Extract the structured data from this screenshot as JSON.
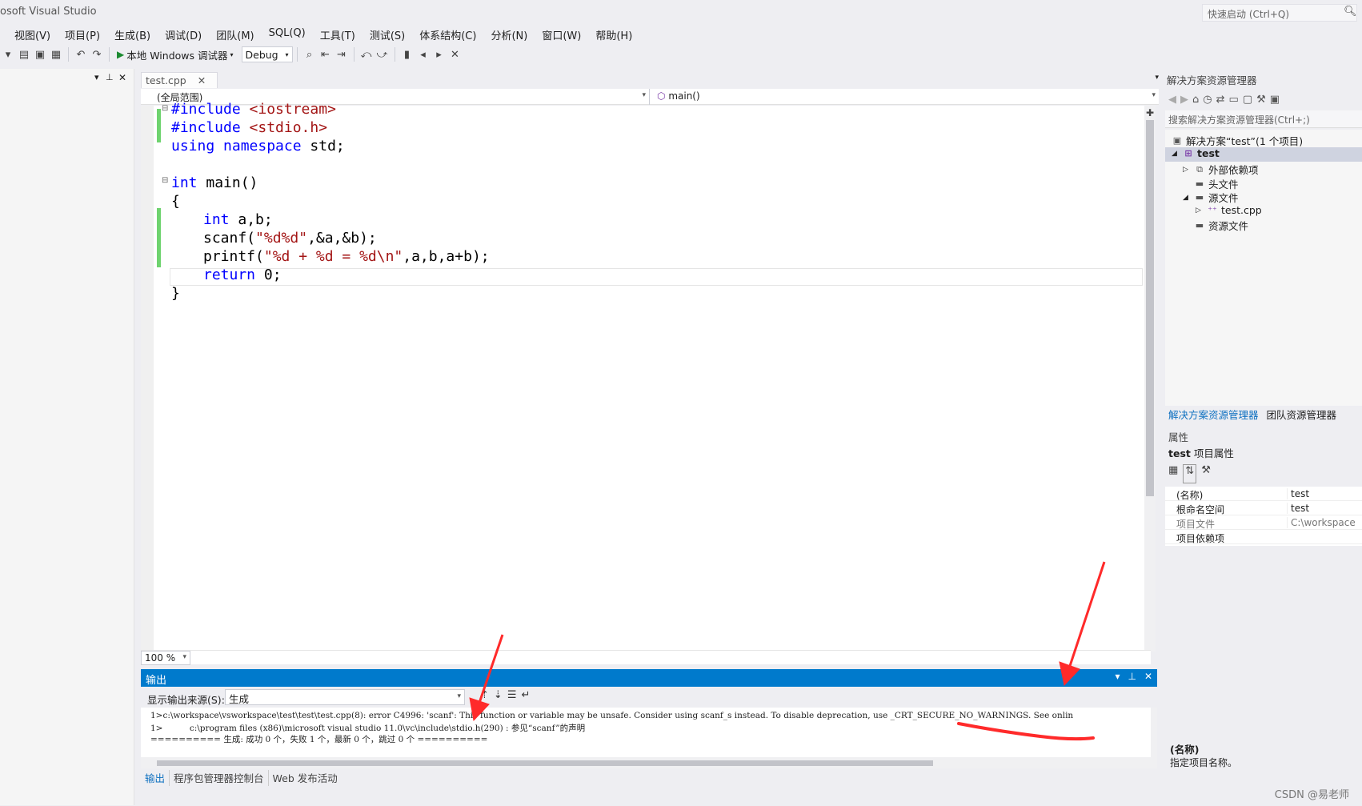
{
  "title_bar": {
    "app_title": "osoft Visual Studio",
    "quick_launch_placeholder": "快速启动 (Ctrl+Q)",
    "quick_launch_icon": "search-icon"
  },
  "menu": [
    "视图(V)",
    "项目(P)",
    "生成(B)",
    "调试(D)",
    "团队(M)",
    "SQL(Q)",
    "工具(T)",
    "测试(S)",
    "体系结构(C)",
    "分析(N)",
    "窗口(W)",
    "帮助(H)"
  ],
  "toolbar": {
    "run_label": "本地 Windows 调试器",
    "config_value": "Debug"
  },
  "editor": {
    "tab_label": "test.cpp",
    "scope": "(全局范围)",
    "function": "main()",
    "zoom": "100 %",
    "code": [
      {
        "kw": "#include",
        "rest": " <iostream>"
      },
      {
        "kw": "#include",
        "rest": " <stdio.h>"
      },
      {
        "kw": "using namespace",
        "rest": " std;"
      },
      {
        "kw": "",
        "rest": ""
      },
      {
        "kw": "int",
        "rest": " main()"
      },
      {
        "kw": "",
        "rest": "{"
      },
      {
        "kw": "int",
        "rest": " a,b;"
      },
      {
        "kw": "",
        "rest": "scanf(\"%d%d\",&a,&b);"
      },
      {
        "kw": "",
        "rest": "printf(\"%d + %d = %d\\n\",a,b,a+b);"
      },
      {
        "kw": "return",
        "rest": " 0;"
      },
      {
        "kw": "",
        "rest": "}"
      }
    ]
  },
  "output": {
    "title": "输出",
    "source_label": "显示输出来源(S):",
    "source_value": "生成",
    "lines": [
      "1>c:\\workspace\\vsworkspace\\test\\test\\test.cpp(8): error C4996: 'scanf': This function or variable may be unsafe. Consider using scanf_s instead. To disable deprecation, use _CRT_SECURE_NO_WARNINGS. See onlin",
      "1>          c:\\program files (x86)\\microsoft visual studio 11.0\\vc\\include\\stdio.h(290) : 参见“scanf”的声明",
      "========== 生成: 成功 0 个，失败 1 个，最新 0 个，跳过 0 个 =========="
    ],
    "tabs": [
      "输出",
      "程序包管理器控制台",
      "Web 发布活动"
    ]
  },
  "solution_explorer": {
    "title": "解决方案资源管理器",
    "search_placeholder": "搜索解决方案资源管理器(Ctrl+;)",
    "solution": "解决方案“test”(1 个项目)",
    "project": "test",
    "nodes": {
      "external": "外部依赖项",
      "headers": "头文件",
      "sources": "源文件",
      "file": "test.cpp",
      "resources": "资源文件"
    },
    "tabs": [
      "解决方案资源管理器",
      "团队资源管理器"
    ]
  },
  "properties": {
    "title": "属性",
    "subject_name": "test",
    "subject_suffix": "项目属性",
    "rows": [
      {
        "name": "(名称)",
        "value": "test"
      },
      {
        "name": "根命名空间",
        "value": "test"
      },
      {
        "name": "项目文件",
        "value": "C:\\workspace"
      },
      {
        "name": "项目依赖项",
        "value": ""
      }
    ],
    "desc_name": "(名称)",
    "desc_text": "指定项目名称。"
  },
  "watermark": "CSDN @易老师",
  "colors": {
    "accent": "#007acc",
    "keyword": "#0000ff",
    "string": "#a31515",
    "annotation": "#ff2a2a"
  }
}
